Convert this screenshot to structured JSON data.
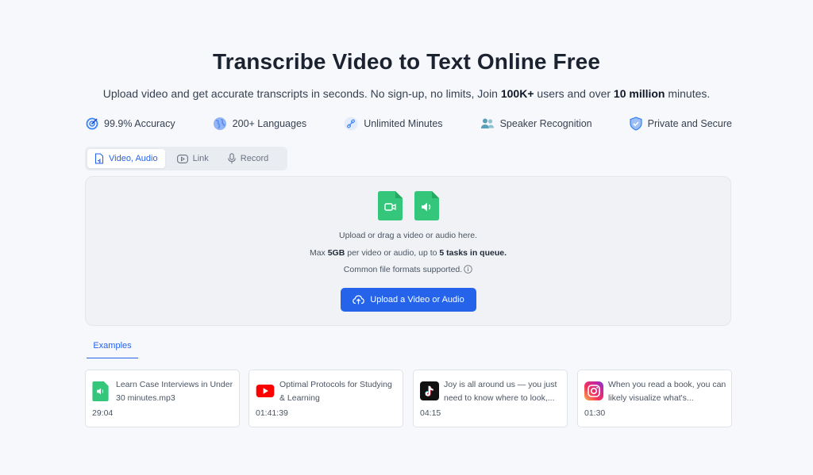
{
  "header": {
    "title": "Transcribe Video to Text Online Free",
    "subtitle_part1": "Upload video and get accurate transcripts in seconds. No sign-up, no limits, Join ",
    "subtitle_bold1": "100K+",
    "subtitle_part2": " users and over ",
    "subtitle_bold2": "10 million",
    "subtitle_part3": " minutes."
  },
  "features": [
    {
      "label": "99.9% Accuracy",
      "icon": "target-icon"
    },
    {
      "label": "200+ Languages",
      "icon": "globe-icon"
    },
    {
      "label": "Unlimited Minutes",
      "icon": "link-icon"
    },
    {
      "label": "Speaker Recognition",
      "icon": "users-icon"
    },
    {
      "label": "Private and Secure",
      "icon": "shield-icon"
    }
  ],
  "tabs": [
    {
      "label": "Video, Audio",
      "active": true,
      "icon": "file-audio-icon"
    },
    {
      "label": "Link",
      "active": false,
      "icon": "youtube-outline-icon"
    },
    {
      "label": "Record",
      "active": false,
      "icon": "microphone-icon"
    }
  ],
  "dropzone": {
    "line1": "Upload or drag a video or audio here.",
    "line2_part1": "Max ",
    "line2_bold1": "5GB",
    "line2_part2": " per video or audio, up to ",
    "line2_bold2": "5 tasks in queue.",
    "line3": "Common file formats supported.",
    "button_label": "Upload a Video or Audio"
  },
  "examples": {
    "tab_label": "Examples",
    "items": [
      {
        "title": "Learn Case Interviews in Under 30 minutes.mp3",
        "duration": "29:04",
        "icon": "audio-file-icon"
      },
      {
        "title": "Optimal Protocols for Studying & Learning",
        "duration": "01:41:39",
        "icon": "youtube-icon"
      },
      {
        "title": "Joy is all around us — you just need to know where to look,...",
        "duration": "04:15",
        "icon": "tiktok-icon"
      },
      {
        "title": "When you read a book, you can likely visualize what's...",
        "duration": "01:30",
        "icon": "instagram-icon"
      }
    ]
  },
  "colors": {
    "accent": "#2563eb",
    "file_green": "#34c77b",
    "background": "#f6f8fb"
  }
}
